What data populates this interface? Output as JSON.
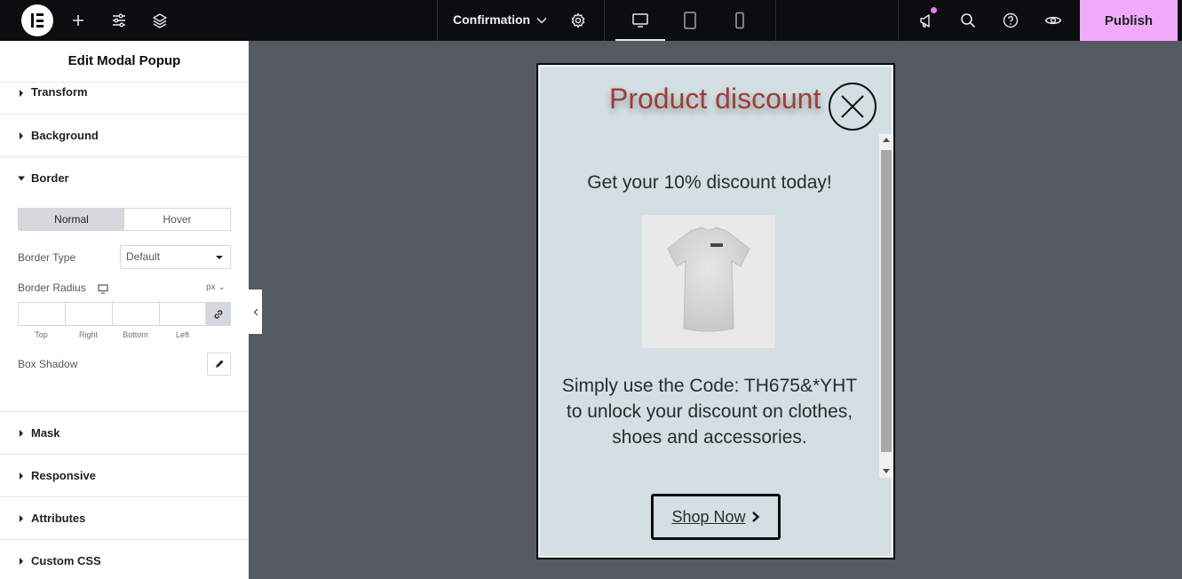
{
  "topbar": {
    "document_title": "Confirmation",
    "publish_label": "Publish",
    "colors": {
      "background": "#0c0d0e",
      "publish": "#f0abfc",
      "notification": "#e879f9"
    }
  },
  "panel": {
    "title": "Edit Modal Popup",
    "sections": {
      "transform": "Transform",
      "background": "Background",
      "border": "Border",
      "mask": "Mask",
      "responsive": "Responsive",
      "attributes": "Attributes",
      "custom_css": "Custom CSS"
    },
    "border": {
      "tab_normal": "Normal",
      "tab_hover": "Hover",
      "border_type_label": "Border Type",
      "border_type_value": "Default",
      "border_radius_label": "Border Radius",
      "unit": "px",
      "dims": {
        "top": "Top",
        "right": "Right",
        "bottom": "Bottom",
        "left": "Left"
      },
      "box_shadow_label": "Box Shadow"
    }
  },
  "popup": {
    "title": "Product discount",
    "headline": "Get your 10% discount today!",
    "body_line1": "Simply use the Code: TH675&*YHT",
    "body_line2": "to unlock your discount on clothes,",
    "body_line3": "shoes and accessories.",
    "button_label": "Shop Now",
    "colors": {
      "background": "#d3dfe3",
      "title": "#9e3d33"
    }
  }
}
